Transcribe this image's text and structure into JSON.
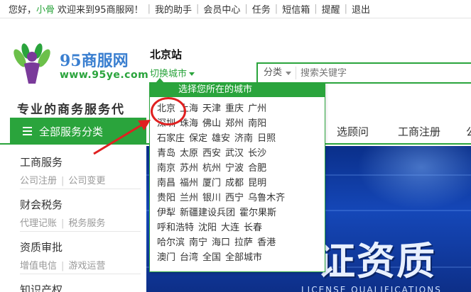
{
  "topbar": {
    "greeting_prefix": "您好，",
    "username": "小骨",
    "welcome": "欢迎来到95商服网！",
    "links": [
      "我的助手",
      "会员中心",
      "任务",
      "短信箱",
      "提醒",
      "退出"
    ]
  },
  "logo": {
    "name": "95商服网",
    "url": "www.95ye.com"
  },
  "location": {
    "city": "北京站",
    "switch_label": "切换城市"
  },
  "search": {
    "category": "分类",
    "placeholder": "搜索关键字"
  },
  "tagline": "专业的商务服务代",
  "nav": {
    "all_categories": "全部服务分类",
    "items": [
      "选顾问",
      "工商注册",
      "公"
    ]
  },
  "sidebar": [
    {
      "title": "工商服务",
      "subs": [
        "公司注册",
        "公司变更"
      ]
    },
    {
      "title": "财会税务",
      "subs": [
        "代理记账",
        "税务服务"
      ]
    },
    {
      "title": "资质审批",
      "subs": [
        "增值电信",
        "游戏运营"
      ]
    },
    {
      "title": "知识产权",
      "subs": []
    }
  ],
  "banner": {
    "headline": "证资质",
    "subtext": "LICENSE QUALIFICATIONS"
  },
  "city_dropdown": {
    "header": "选择您所在的城市",
    "rows": [
      [
        "北京",
        "上海",
        "天津",
        "重庆",
        "广州"
      ],
      [
        "深圳",
        "珠海",
        "佛山",
        "郑州",
        "南阳"
      ],
      [
        "石家庄",
        "保定",
        "雄安",
        "济南",
        "日照"
      ],
      [
        "青岛",
        "太原",
        "西安",
        "武汉",
        "长沙"
      ],
      [
        "南京",
        "苏州",
        "杭州",
        "宁波",
        "合肥"
      ],
      [
        "南昌",
        "福州",
        "厦门",
        "成都",
        "昆明"
      ],
      [
        "贵阳",
        "兰州",
        "银川",
        "西宁",
        "乌鲁木齐"
      ],
      [
        "伊犁",
        "新疆建设兵团",
        "霍尔果斯"
      ],
      [
        "呼和浩特",
        "沈阳",
        "大连",
        "长春"
      ],
      [
        "哈尔滨",
        "南宁",
        "海口",
        "拉萨",
        "香港"
      ],
      [
        "澳门",
        "台湾",
        "全国",
        "全部城市"
      ]
    ]
  },
  "colors": {
    "brand_green": "#2aa43c",
    "annotation_red": "#e02020",
    "banner_blue": "#1547b8"
  }
}
